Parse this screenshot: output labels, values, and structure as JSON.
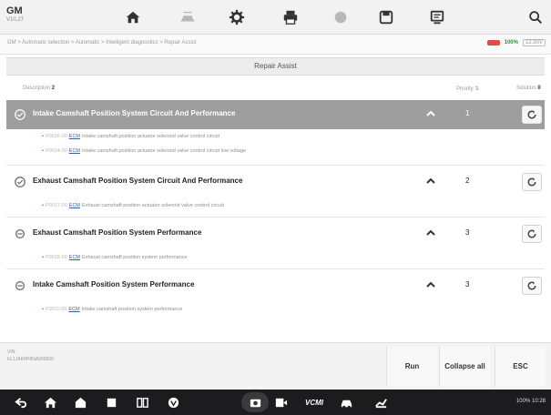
{
  "brand": {
    "name": "GM",
    "sub": "V10.27"
  },
  "toolbar": {
    "icons": [
      "home-icon",
      "vehicle-swap-icon",
      "settings-icon",
      "print-icon",
      "help-icon",
      "save-icon",
      "data-icon",
      "search-icon"
    ]
  },
  "breadcrumb": "GM > Automatic selection > Automatic > Intelligent diagnostics > Repair Assist",
  "status": {
    "battery_pct": "100%",
    "voltage": "12.30V"
  },
  "page_title": "Repair Assist",
  "columns": {
    "description_label": "Description",
    "description_count": "2",
    "priority_label": "Priority",
    "fix_label": "Solution",
    "fix_count": "0"
  },
  "rows": [
    {
      "title": "Intake Camshaft Position System Circuit And Performance",
      "priority": "1",
      "selected": true,
      "subs": [
        {
          "code": "P0016-00",
          "module": "ECM",
          "text": "Intake camshaft position actuator solenoid valve control circuit"
        },
        {
          "code": "P0014-00",
          "module": "ECM",
          "text": "Intake camshaft position actuator solenoid valve control circuit low voltage"
        }
      ]
    },
    {
      "title": "Exhaust Camshaft Position System Circuit And Performance",
      "priority": "2",
      "selected": false,
      "subs": [
        {
          "code": "P0017-00",
          "module": "ECM",
          "text": "Exhaust camshaft position actuator solenoid valve control circuit"
        }
      ]
    },
    {
      "title": "Exhaust Camshaft Position System Performance",
      "priority": "3",
      "selected": false,
      "subs": [
        {
          "code": "P0015-00",
          "module": "ECM",
          "text": "Exhaust camshaft position system performance"
        }
      ]
    },
    {
      "title": "Intake Camshaft Position System Performance",
      "priority": "3",
      "selected": false,
      "subs": [
        {
          "code": "P0011-00",
          "module": "ECM",
          "text": "Intake camshaft position system performance"
        }
      ]
    }
  ],
  "vehicle_info": {
    "line1": "VIN:",
    "line2": "KL1JA6HP8NA000000"
  },
  "buttons": {
    "run": "Run",
    "collapse_all": "Collapse all",
    "esc": "ESC"
  },
  "system_status": "100% 10:28",
  "nav_label_vci": "VCMI"
}
